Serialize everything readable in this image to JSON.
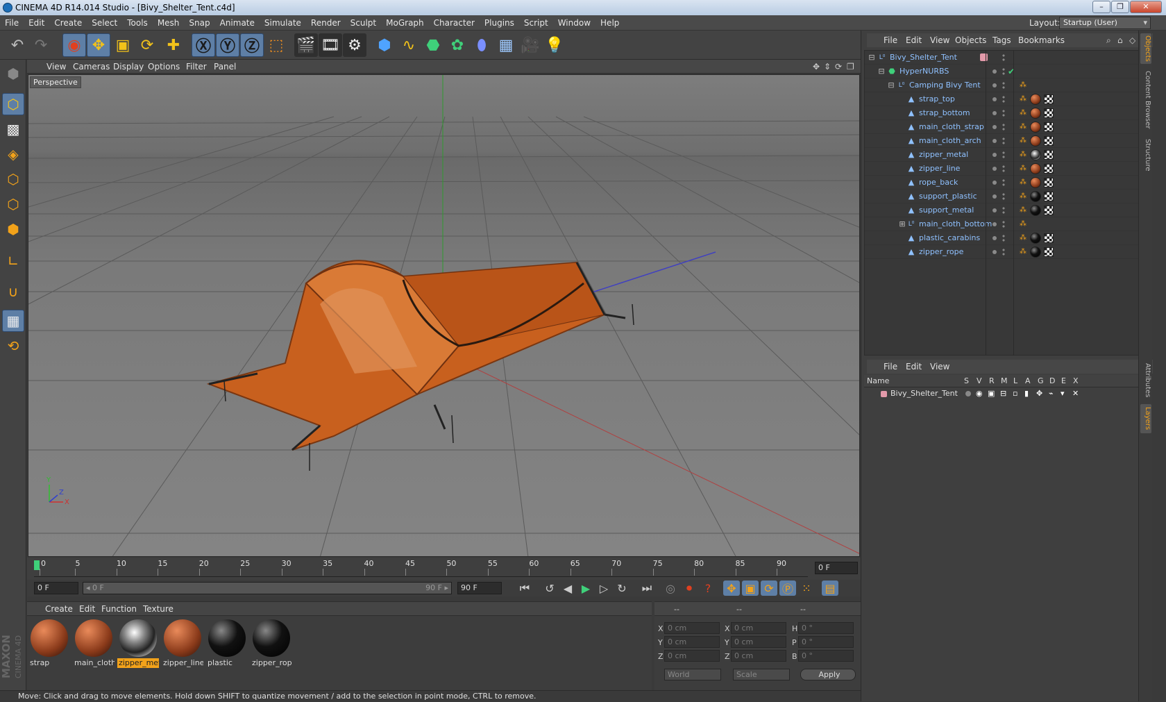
{
  "window": {
    "title": "CINEMA 4D R14.014 Studio - [Bivy_Shelter_Tent.c4d]",
    "controls": [
      "–",
      "❐",
      "✕"
    ]
  },
  "menubar": {
    "items": [
      "File",
      "Edit",
      "Create",
      "Select",
      "Tools",
      "Mesh",
      "Snap",
      "Animate",
      "Simulate",
      "Render",
      "Sculpt",
      "MoGraph",
      "Character",
      "Plugins",
      "Script",
      "Window",
      "Help"
    ],
    "layout_label": "Layout:",
    "layout_value": "Startup (User)"
  },
  "viewport": {
    "menu": [
      "View",
      "Cameras",
      "Display",
      "Options",
      "Filter",
      "Panel"
    ],
    "label": "Perspective",
    "axis_x": "X",
    "axis_y": "Y",
    "axis_z": "Z"
  },
  "timeline": {
    "ticks": [
      "0",
      "5",
      "10",
      "15",
      "20",
      "25",
      "30",
      "35",
      "40",
      "45",
      "50",
      "55",
      "60",
      "65",
      "70",
      "75",
      "80",
      "85",
      "90"
    ],
    "current_frame": "0 F",
    "start_field": "0 F",
    "range_start": "◂ 0 F",
    "range_end": "90 F ▸",
    "end_field": "90 F"
  },
  "materials": {
    "menu": [
      "Create",
      "Edit",
      "Function",
      "Texture"
    ],
    "items": [
      {
        "name": "strap",
        "kind": "orange",
        "selected": false
      },
      {
        "name": "main_cloth",
        "kind": "orange",
        "selected": false
      },
      {
        "name": "zipper_met",
        "kind": "chrome",
        "selected": true
      },
      {
        "name": "zipper_line",
        "kind": "orange",
        "selected": false
      },
      {
        "name": "plastic",
        "kind": "black",
        "selected": false
      },
      {
        "name": "zipper_rop",
        "kind": "black",
        "selected": false
      }
    ],
    "brand_line1": "MAXON",
    "brand_line2": "CINEMA 4D"
  },
  "coordinates": {
    "headers": [
      "--",
      "--",
      "--"
    ],
    "rows": [
      {
        "a": "X",
        "av": "0 cm",
        "b": "X",
        "bv": "0 cm",
        "c": "H",
        "cv": "0 °"
      },
      {
        "a": "Y",
        "av": "0 cm",
        "b": "Y",
        "bv": "0 cm",
        "c": "P",
        "cv": "0 °"
      },
      {
        "a": "Z",
        "av": "0 cm",
        "b": "Z",
        "bv": "0 cm",
        "c": "B",
        "cv": "0 °"
      }
    ],
    "space": "World",
    "mode": "Scale",
    "apply": "Apply"
  },
  "status": "Move: Click and drag to move elements. Hold down SHIFT to quantize movement / add to the selection in point mode, CTRL to remove.",
  "objects": {
    "menu": [
      "File",
      "Edit",
      "View",
      "Objects",
      "Tags",
      "Bookmarks"
    ],
    "rows": [
      {
        "name": "Bivy_Shelter_Tent",
        "depth": 0,
        "icon": "null",
        "tags": "layer"
      },
      {
        "name": "HyperNURBS",
        "depth": 1,
        "icon": "nurbs",
        "tags": "check"
      },
      {
        "name": "Camping Bivy Tent",
        "depth": 2,
        "icon": "null",
        "tags": "phong"
      },
      {
        "name": "strap_top",
        "depth": 3,
        "icon": "poly",
        "tags": "orange"
      },
      {
        "name": "strap_bottom",
        "depth": 3,
        "icon": "poly",
        "tags": "orange"
      },
      {
        "name": "main_cloth_strap",
        "depth": 3,
        "icon": "poly",
        "tags": "orange"
      },
      {
        "name": "main_cloth_arch",
        "depth": 3,
        "icon": "poly",
        "tags": "orange"
      },
      {
        "name": "zipper_metal",
        "depth": 3,
        "icon": "poly",
        "tags": "chrome"
      },
      {
        "name": "zipper_line",
        "depth": 3,
        "icon": "poly",
        "tags": "orange"
      },
      {
        "name": "rope_back",
        "depth": 3,
        "icon": "poly",
        "tags": "orange"
      },
      {
        "name": "support_plastic",
        "depth": 3,
        "icon": "poly",
        "tags": "black"
      },
      {
        "name": "support_metal",
        "depth": 3,
        "icon": "poly",
        "tags": "black"
      },
      {
        "name": "main_cloth_bottom",
        "depth": 3,
        "icon": "null",
        "tags": "phong"
      },
      {
        "name": "plastic_carabins",
        "depth": 3,
        "icon": "poly",
        "tags": "black"
      },
      {
        "name": "zipper_rope",
        "depth": 3,
        "icon": "poly",
        "tags": "black"
      }
    ]
  },
  "layers": {
    "menu": [
      "File",
      "Edit",
      "View"
    ],
    "columns": [
      "Name",
      "S",
      "V",
      "R",
      "M",
      "L",
      "A",
      "G",
      "D",
      "E",
      "X"
    ],
    "row_name": "Bivy_Shelter_Tent"
  },
  "side_tabs": [
    "Objects",
    "Content Browser",
    "Structure",
    "Attributes",
    "Layers"
  ],
  "colors": {
    "accent": "#f2a21a",
    "selection": "#5e7fa6",
    "object_name": "#8fc1ff",
    "tent": "#c8601e"
  }
}
